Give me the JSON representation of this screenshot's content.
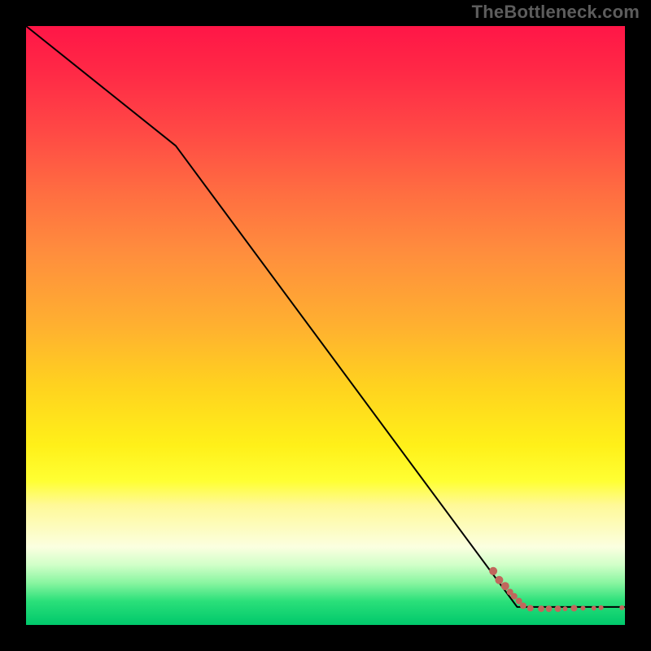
{
  "watermark": "TheBottleneck.com",
  "chart_data": {
    "type": "line",
    "title": "",
    "xlabel": "",
    "ylabel": "",
    "xlim": [
      0,
      100
    ],
    "ylim": [
      0,
      100
    ],
    "grid": false,
    "colors": {
      "gradient_top": "#ff1647",
      "gradient_bottom": "#00c86b",
      "line": "#000000",
      "marker": "#c1675c"
    },
    "series": [
      {
        "name": "curve",
        "style": "line",
        "x": [
          0,
          25,
          82,
          100
        ],
        "y": [
          100,
          80,
          3,
          3
        ]
      },
      {
        "name": "markers",
        "style": "scatter",
        "points": [
          {
            "x": 78.0,
            "y": 9.0,
            "r": 5
          },
          {
            "x": 79.0,
            "y": 7.5,
            "r": 5
          },
          {
            "x": 80.0,
            "y": 6.5,
            "r": 5
          },
          {
            "x": 80.8,
            "y": 5.5,
            "r": 4
          },
          {
            "x": 81.5,
            "y": 4.8,
            "r": 4
          },
          {
            "x": 82.3,
            "y": 4.0,
            "r": 4
          },
          {
            "x": 83.0,
            "y": 3.2,
            "r": 4
          },
          {
            "x": 84.2,
            "y": 2.8,
            "r": 4
          },
          {
            "x": 86.0,
            "y": 2.7,
            "r": 4
          },
          {
            "x": 87.3,
            "y": 2.7,
            "r": 4
          },
          {
            "x": 88.8,
            "y": 2.7,
            "r": 4
          },
          {
            "x": 90.0,
            "y": 2.7,
            "r": 3
          },
          {
            "x": 91.5,
            "y": 2.8,
            "r": 4
          },
          {
            "x": 93.0,
            "y": 2.8,
            "r": 3
          },
          {
            "x": 94.8,
            "y": 2.8,
            "r": 3
          },
          {
            "x": 96.0,
            "y": 2.9,
            "r": 3
          },
          {
            "x": 99.5,
            "y": 2.9,
            "r": 3
          }
        ]
      }
    ]
  }
}
